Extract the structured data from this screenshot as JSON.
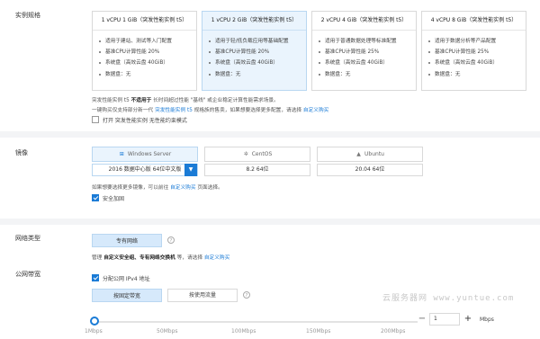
{
  "instance": {
    "label": "实例规格",
    "cards": [
      {
        "title": "1 vCPU 1 GiB（突发性能实例 t5）",
        "selected": false,
        "features": [
          "适用于建站、测试等入门配置",
          "基准CPU计算性能 20%",
          "系统盘（高效云盘 40GiB）",
          "数据盘：无"
        ]
      },
      {
        "title": "1 vCPU 2 GiB（突发性能实例 t5）",
        "selected": true,
        "features": [
          "适用于轻/低负载应用等基础配置",
          "基准CPU计算性能 20%",
          "系统盘（高效云盘 40GiB）",
          "数据盘：无"
        ]
      },
      {
        "title": "2 vCPU 4 GiB（突发性能实例 t5）",
        "selected": false,
        "features": [
          "适用于普通数据处理等标准配置",
          "基准CPU计算性能 25%",
          "系统盘（高效云盘 40GiB）",
          "数据盘：无"
        ]
      },
      {
        "title": "4 vCPU 8 GiB（突发性能实例 t5）",
        "selected": false,
        "features": [
          "适用于数据分析等产品配置",
          "基准CPU计算性能 25%",
          "系统盘（高效云盘 40GiB）",
          "数据盘：无"
        ]
      }
    ],
    "note1_pre": "突发性能实例 t5 ",
    "note1_bold": "不适用于",
    "note1_post": " 长时间超过性能 \"基线\" 或企业稳定计算性能需求场景。",
    "note2_pre": "一键购买仅支持部分新一代 ",
    "note2_link": "突发性能实例 t5",
    "note2_mid": " 规格族的售卖，如果想要选择更多配置，请选择 ",
    "note2_link2": "自定义购买",
    "unlimited_label": "打开 突发性能实例 无性能约束模式",
    "unlimited_checked": false
  },
  "image": {
    "label": "镜像",
    "tabs": [
      {
        "icon": "windows-icon",
        "name": "Windows Server",
        "version": "2016 数据中心版 64位中文版",
        "selected": true
      },
      {
        "icon": "centos-icon",
        "name": "CentOS",
        "version": "8.2 64位",
        "selected": false
      },
      {
        "icon": "ubuntu-icon",
        "name": "Ubuntu",
        "version": "20.04 64位",
        "selected": false
      }
    ],
    "note_pre": "如果想要选择更多镜像，可以前往 ",
    "note_link": "自定义购买",
    "note_post": " 页面选择。",
    "security_label": "安全加固",
    "security_checked": true
  },
  "network": {
    "type_label": "网络类型",
    "type_button": "专有网络",
    "type_note_pre": "管理 ",
    "type_note_bold": "自定义安全组、专有网络交换机",
    "type_note_mid": " 等，请选择 ",
    "type_note_link": "自定义购买",
    "bandwidth_label": "公网带宽",
    "ipv4_label": "分配公网 IPv4 地址",
    "ipv4_checked": true,
    "billing_fixed": "按固定带宽",
    "billing_traffic": "按使用流量",
    "slider_ticks": [
      "1Mbps",
      "50Mbps",
      "100Mbps",
      "150Mbps",
      "200Mbps"
    ],
    "bandwidth_value": "1",
    "bandwidth_unit": "Mbps",
    "minus": "−",
    "plus": "+"
  },
  "watermark": "云服务器网 www.yuntue.com",
  "colors": {
    "accent": "#1a7bd6",
    "selected_bg": "#eaf4fd"
  }
}
